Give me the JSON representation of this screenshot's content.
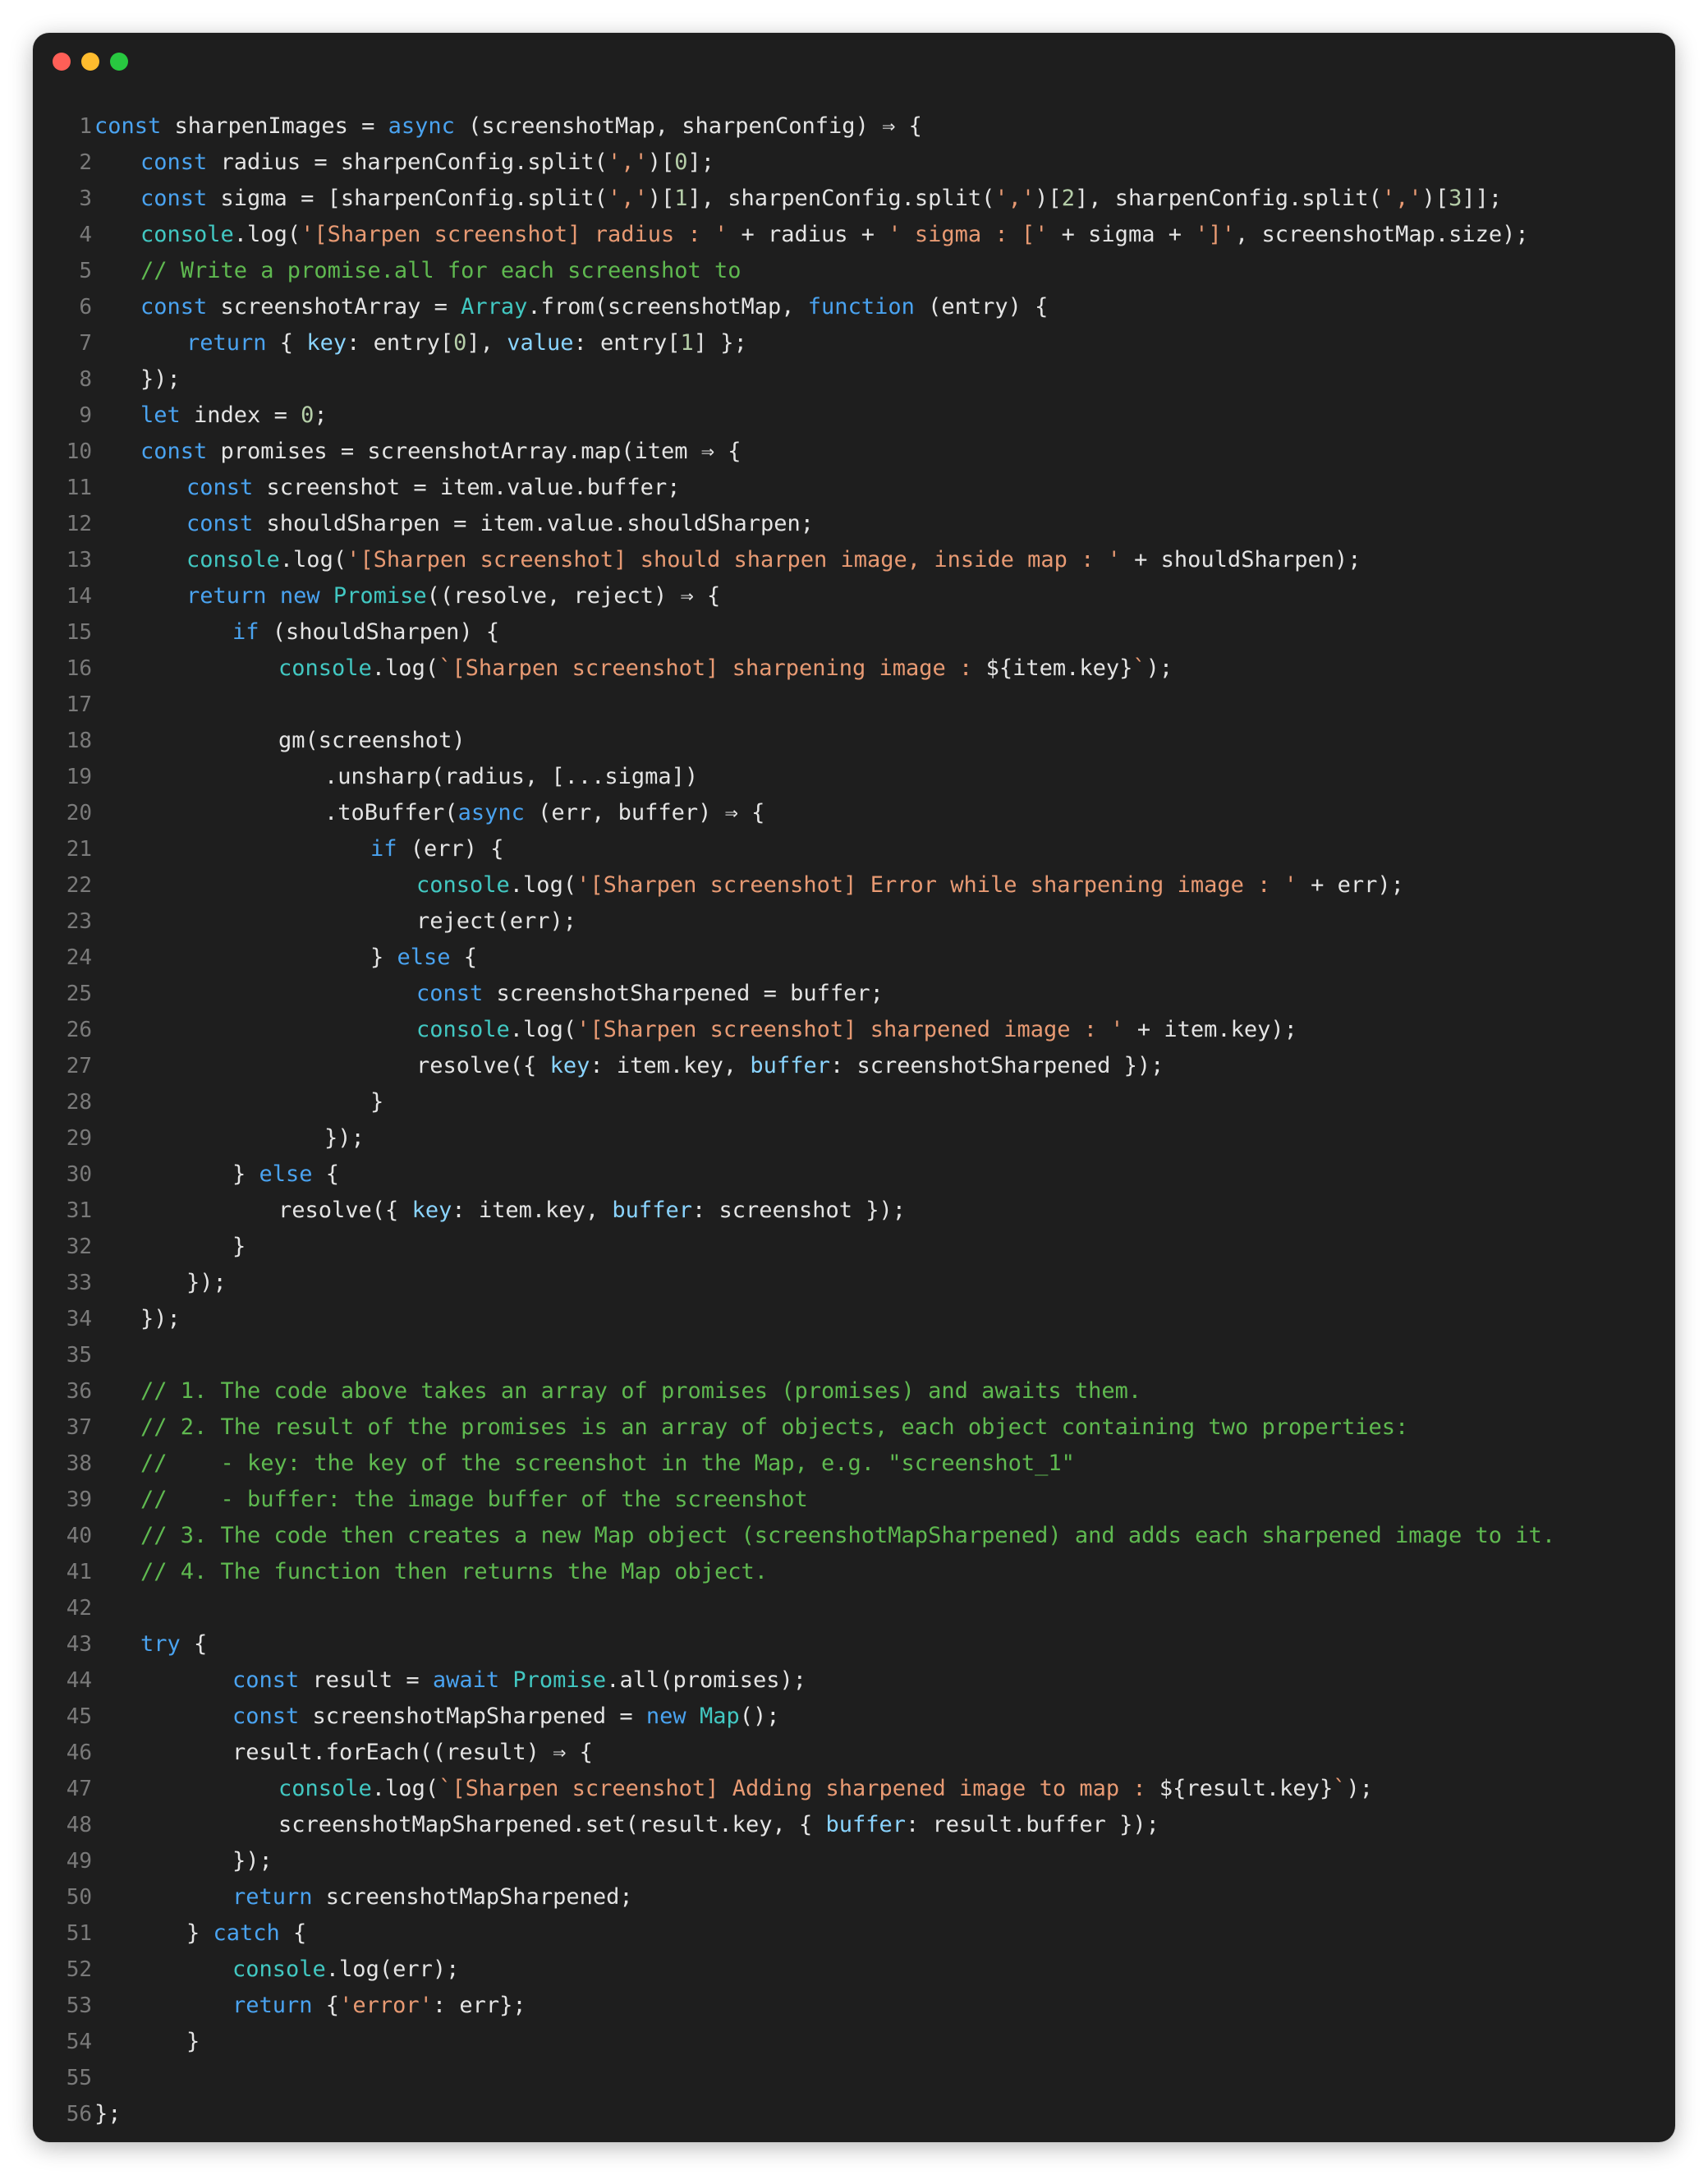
{
  "window": {
    "controls": [
      "close",
      "minimize",
      "zoom"
    ]
  },
  "colors": {
    "background": "#1e1e1e",
    "keyword": "#4aa3f0",
    "string": "#e89a73",
    "comment": "#5fb950",
    "builtin": "#42c8c2",
    "number": "#b5cea8",
    "property": "#8ad4ff",
    "text": "#e4e4e4",
    "line_number": "#7a7a7a"
  },
  "code": {
    "lines": [
      {
        "n": "1",
        "indent": 0,
        "tokens": [
          [
            "kw",
            "const"
          ],
          [
            "p",
            " sharpenImages = "
          ],
          [
            "kw",
            "async"
          ],
          [
            "p",
            " (screenshotMap, sharpenConfig) ⇒ {"
          ]
        ]
      },
      {
        "n": "2",
        "indent": 1,
        "tokens": [
          [
            "kw",
            "const"
          ],
          [
            "p",
            " radius = sharpenConfig.split("
          ],
          [
            "str",
            "','"
          ],
          [
            "p",
            ")["
          ],
          [
            "num",
            "0"
          ],
          [
            "p",
            "];"
          ]
        ]
      },
      {
        "n": "3",
        "indent": 1,
        "tokens": [
          [
            "kw",
            "const"
          ],
          [
            "p",
            " sigma = [sharpenConfig.split("
          ],
          [
            "str",
            "','"
          ],
          [
            "p",
            ")["
          ],
          [
            "num",
            "1"
          ],
          [
            "p",
            "], sharpenConfig.split("
          ],
          [
            "str",
            "','"
          ],
          [
            "p",
            ")["
          ],
          [
            "num",
            "2"
          ],
          [
            "p",
            "], sharpenConfig.split("
          ],
          [
            "str",
            "','"
          ],
          [
            "p",
            ")["
          ],
          [
            "num",
            "3"
          ],
          [
            "p",
            "]];"
          ]
        ]
      },
      {
        "n": "4",
        "indent": 1,
        "tokens": [
          [
            "fn",
            "console"
          ],
          [
            "p",
            ".log("
          ],
          [
            "str",
            "'[Sharpen screenshot] radius : '"
          ],
          [
            "p",
            " + radius + "
          ],
          [
            "str",
            "' sigma : ['"
          ],
          [
            "p",
            " + sigma + "
          ],
          [
            "str",
            "']'"
          ],
          [
            "p",
            ", screenshotMap.size);"
          ]
        ]
      },
      {
        "n": "5",
        "indent": 1,
        "tokens": [
          [
            "cm",
            "// Write a promise.all for each screenshot to"
          ]
        ]
      },
      {
        "n": "6",
        "indent": 1,
        "tokens": [
          [
            "kw",
            "const"
          ],
          [
            "p",
            " screenshotArray = "
          ],
          [
            "fn",
            "Array"
          ],
          [
            "p",
            ".from(screenshotMap, "
          ],
          [
            "kw",
            "function"
          ],
          [
            "p",
            " (entry) {"
          ]
        ]
      },
      {
        "n": "7",
        "indent": 2,
        "tokens": [
          [
            "kw",
            "return"
          ],
          [
            "p",
            " { "
          ],
          [
            "prop",
            "key"
          ],
          [
            "p",
            ": entry["
          ],
          [
            "num",
            "0"
          ],
          [
            "p",
            "], "
          ],
          [
            "prop",
            "value"
          ],
          [
            "p",
            ": entry["
          ],
          [
            "num",
            "1"
          ],
          [
            "p",
            "] };"
          ]
        ]
      },
      {
        "n": "8",
        "indent": 1,
        "tokens": [
          [
            "p",
            "});"
          ]
        ]
      },
      {
        "n": "9",
        "indent": 1,
        "tokens": [
          [
            "kw",
            "let"
          ],
          [
            "p",
            " index = "
          ],
          [
            "num",
            "0"
          ],
          [
            "p",
            ";"
          ]
        ]
      },
      {
        "n": "10",
        "indent": 1,
        "tokens": [
          [
            "kw",
            "const"
          ],
          [
            "p",
            " promises = screenshotArray.map(item ⇒ {"
          ]
        ]
      },
      {
        "n": "11",
        "indent": 2,
        "tokens": [
          [
            "kw",
            "const"
          ],
          [
            "p",
            " screenshot = item.value.buffer;"
          ]
        ]
      },
      {
        "n": "12",
        "indent": 2,
        "tokens": [
          [
            "kw",
            "const"
          ],
          [
            "p",
            " shouldSharpen = item.value.shouldSharpen;"
          ]
        ]
      },
      {
        "n": "13",
        "indent": 2,
        "tokens": [
          [
            "fn",
            "console"
          ],
          [
            "p",
            ".log("
          ],
          [
            "str",
            "'[Sharpen screenshot] should sharpen image, inside map : '"
          ],
          [
            "p",
            " + shouldSharpen);"
          ]
        ]
      },
      {
        "n": "14",
        "indent": 2,
        "tokens": [
          [
            "kw",
            "return"
          ],
          [
            "p",
            " "
          ],
          [
            "kw",
            "new"
          ],
          [
            "p",
            " "
          ],
          [
            "fn",
            "Promise"
          ],
          [
            "p",
            "((resolve, reject) ⇒ {"
          ]
        ]
      },
      {
        "n": "15",
        "indent": 3,
        "tokens": [
          [
            "kw",
            "if"
          ],
          [
            "p",
            " (shouldSharpen) {"
          ]
        ]
      },
      {
        "n": "16",
        "indent": 4,
        "tokens": [
          [
            "fn",
            "console"
          ],
          [
            "p",
            ".log("
          ],
          [
            "str",
            "`[Sharpen screenshot] sharpening image : "
          ],
          [
            "p",
            "${item.key}"
          ],
          [
            "str",
            "`"
          ],
          [
            "p",
            ");"
          ]
        ]
      },
      {
        "n": "17",
        "indent": 0,
        "tokens": []
      },
      {
        "n": "18",
        "indent": 4,
        "tokens": [
          [
            "p",
            "gm(screenshot)"
          ]
        ]
      },
      {
        "n": "19",
        "indent": 5,
        "tokens": [
          [
            "p",
            ".unsharp(radius, [...sigma])"
          ]
        ]
      },
      {
        "n": "20",
        "indent": 5,
        "tokens": [
          [
            "p",
            ".toBuffer("
          ],
          [
            "kw",
            "async"
          ],
          [
            "p",
            " (err, buffer) ⇒ {"
          ]
        ]
      },
      {
        "n": "21",
        "indent": 6,
        "tokens": [
          [
            "kw",
            "if"
          ],
          [
            "p",
            " (err) {"
          ]
        ]
      },
      {
        "n": "22",
        "indent": 7,
        "tokens": [
          [
            "fn",
            "console"
          ],
          [
            "p",
            ".log("
          ],
          [
            "str",
            "'[Sharpen screenshot] Error while sharpening image : '"
          ],
          [
            "p",
            " + err);"
          ]
        ]
      },
      {
        "n": "23",
        "indent": 7,
        "tokens": [
          [
            "p",
            "reject(err);"
          ]
        ]
      },
      {
        "n": "24",
        "indent": 6,
        "tokens": [
          [
            "p",
            "} "
          ],
          [
            "kw",
            "else"
          ],
          [
            "p",
            " {"
          ]
        ]
      },
      {
        "n": "25",
        "indent": 7,
        "tokens": [
          [
            "kw",
            "const"
          ],
          [
            "p",
            " screenshotSharpened = buffer;"
          ]
        ]
      },
      {
        "n": "26",
        "indent": 7,
        "tokens": [
          [
            "fn",
            "console"
          ],
          [
            "p",
            ".log("
          ],
          [
            "str",
            "'[Sharpen screenshot] sharpened image : '"
          ],
          [
            "p",
            " + item.key);"
          ]
        ]
      },
      {
        "n": "27",
        "indent": 7,
        "tokens": [
          [
            "p",
            "resolve({ "
          ],
          [
            "prop",
            "key"
          ],
          [
            "p",
            ": item.key, "
          ],
          [
            "prop",
            "buffer"
          ],
          [
            "p",
            ": screenshotSharpened });"
          ]
        ]
      },
      {
        "n": "28",
        "indent": 6,
        "tokens": [
          [
            "p",
            "}"
          ]
        ]
      },
      {
        "n": "29",
        "indent": 5,
        "tokens": [
          [
            "p",
            "});"
          ]
        ]
      },
      {
        "n": "30",
        "indent": 3,
        "tokens": [
          [
            "p",
            "} "
          ],
          [
            "kw",
            "else"
          ],
          [
            "p",
            " {"
          ]
        ]
      },
      {
        "n": "31",
        "indent": 4,
        "tokens": [
          [
            "p",
            "resolve({ "
          ],
          [
            "prop",
            "key"
          ],
          [
            "p",
            ": item.key, "
          ],
          [
            "prop",
            "buffer"
          ],
          [
            "p",
            ": screenshot });"
          ]
        ]
      },
      {
        "n": "32",
        "indent": 3,
        "tokens": [
          [
            "p",
            "}"
          ]
        ]
      },
      {
        "n": "33",
        "indent": 2,
        "tokens": [
          [
            "p",
            "});"
          ]
        ]
      },
      {
        "n": "34",
        "indent": 1,
        "tokens": [
          [
            "p",
            "});"
          ]
        ]
      },
      {
        "n": "35",
        "indent": 0,
        "tokens": []
      },
      {
        "n": "36",
        "indent": 1,
        "tokens": [
          [
            "cm",
            "// 1. The code above takes an array of promises (promises) and awaits them."
          ]
        ]
      },
      {
        "n": "37",
        "indent": 1,
        "tokens": [
          [
            "cm",
            "// 2. The result of the promises is an array of objects, each object containing two properties:"
          ]
        ]
      },
      {
        "n": "38",
        "indent": 1,
        "tokens": [
          [
            "cm",
            "//    - key: the key of the screenshot in the Map, e.g. \"screenshot_1\""
          ]
        ]
      },
      {
        "n": "39",
        "indent": 1,
        "tokens": [
          [
            "cm",
            "//    - buffer: the image buffer of the screenshot"
          ]
        ]
      },
      {
        "n": "40",
        "indent": 1,
        "tokens": [
          [
            "cm",
            "// 3. The code then creates a new Map object (screenshotMapSharpened) and adds each sharpened image to it."
          ]
        ]
      },
      {
        "n": "41",
        "indent": 1,
        "tokens": [
          [
            "cm",
            "// 4. The function then returns the Map object."
          ]
        ]
      },
      {
        "n": "42",
        "indent": 0,
        "tokens": []
      },
      {
        "n": "43",
        "indent": 1,
        "tokens": [
          [
            "kw",
            "try"
          ],
          [
            "p",
            " {"
          ]
        ]
      },
      {
        "n": "44",
        "indent": 3,
        "tokens": [
          [
            "kw",
            "const"
          ],
          [
            "p",
            " result = "
          ],
          [
            "kw",
            "await"
          ],
          [
            "p",
            " "
          ],
          [
            "fn",
            "Promise"
          ],
          [
            "p",
            ".all(promises);"
          ]
        ]
      },
      {
        "n": "45",
        "indent": 3,
        "tokens": [
          [
            "kw",
            "const"
          ],
          [
            "p",
            " screenshotMapSharpened = "
          ],
          [
            "kw",
            "new"
          ],
          [
            "p",
            " "
          ],
          [
            "fn",
            "Map"
          ],
          [
            "p",
            "();"
          ]
        ]
      },
      {
        "n": "46",
        "indent": 3,
        "tokens": [
          [
            "p",
            "result.forEach((result) ⇒ {"
          ]
        ]
      },
      {
        "n": "47",
        "indent": 4,
        "tokens": [
          [
            "fn",
            "console"
          ],
          [
            "p",
            ".log("
          ],
          [
            "str",
            "`[Sharpen screenshot] Adding sharpened image to map : "
          ],
          [
            "p",
            "${result.key}"
          ],
          [
            "str",
            "`"
          ],
          [
            "p",
            ");"
          ]
        ]
      },
      {
        "n": "48",
        "indent": 4,
        "tokens": [
          [
            "p",
            "screenshotMapSharpened.set(result.key, { "
          ],
          [
            "prop",
            "buffer"
          ],
          [
            "p",
            ": result.buffer });"
          ]
        ]
      },
      {
        "n": "49",
        "indent": 3,
        "tokens": [
          [
            "p",
            "});"
          ]
        ]
      },
      {
        "n": "50",
        "indent": 3,
        "tokens": [
          [
            "kw",
            "return"
          ],
          [
            "p",
            " screenshotMapSharpened;"
          ]
        ]
      },
      {
        "n": "51",
        "indent": 2,
        "tokens": [
          [
            "p",
            "} "
          ],
          [
            "kw",
            "catch"
          ],
          [
            "p",
            " {"
          ]
        ]
      },
      {
        "n": "52",
        "indent": 3,
        "tokens": [
          [
            "fn",
            "console"
          ],
          [
            "p",
            ".log(err);"
          ]
        ]
      },
      {
        "n": "53",
        "indent": 3,
        "tokens": [
          [
            "kw",
            "return"
          ],
          [
            "p",
            " {"
          ],
          [
            "str",
            "'error'"
          ],
          [
            "p",
            ": err};"
          ]
        ]
      },
      {
        "n": "54",
        "indent": 2,
        "tokens": [
          [
            "p",
            "}"
          ]
        ]
      },
      {
        "n": "55",
        "indent": 0,
        "tokens": []
      },
      {
        "n": "56",
        "indent": 0,
        "tokens": [
          [
            "p",
            "};"
          ]
        ]
      }
    ]
  }
}
